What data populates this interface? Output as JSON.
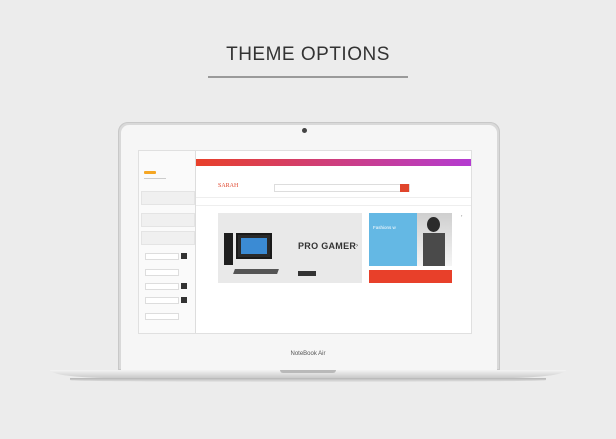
{
  "header": {
    "title": "THEME OPTIONS"
  },
  "laptop": {
    "brand": "NoteBook Air"
  },
  "site": {
    "logo": "SARAH",
    "hero_title": "PRO GAMER",
    "fashion_label": "Fashions w"
  },
  "colors": {
    "accent": "#e8402a",
    "topbar_start": "#e8402a",
    "topbar_end": "#b43bd1",
    "fashion_bg": "#64b8e4",
    "panel_badge": "#f5a623"
  }
}
